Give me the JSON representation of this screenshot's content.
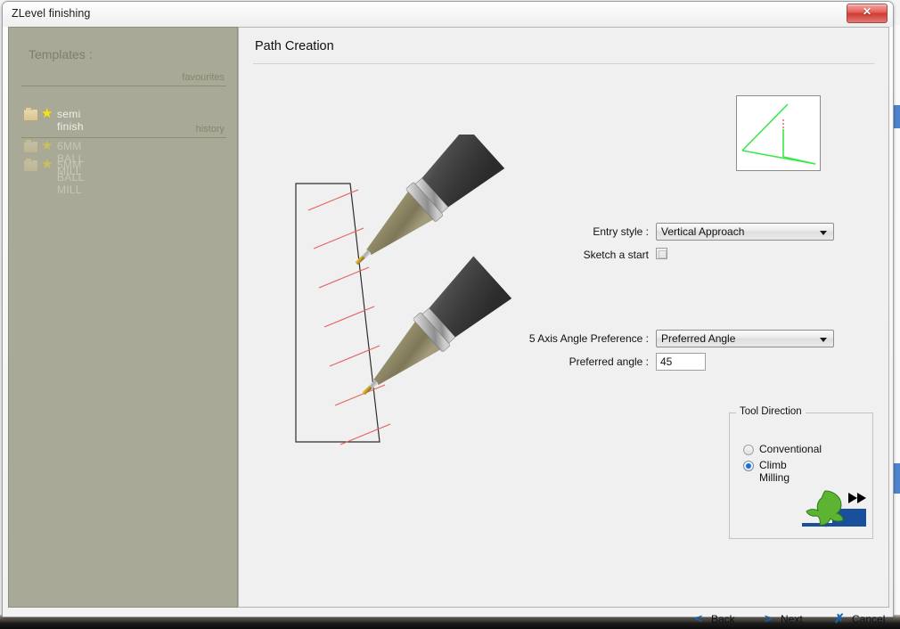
{
  "window": {
    "title": "ZLevel finishing",
    "close_label": "✕",
    "close_icon": "close-icon"
  },
  "sidebar": {
    "heading": "Templates :",
    "sections": [
      {
        "label": "favourites"
      },
      {
        "label": "history"
      }
    ],
    "favourites": [
      {
        "name": "semi finish",
        "icon": "folder-icon",
        "star": "★",
        "active": true
      }
    ],
    "history": [
      {
        "name": "6MM BALL MILL",
        "icon": "folder-icon",
        "star": "★",
        "active": false
      },
      {
        "name": "5MM BALL MILL",
        "icon": "folder-icon",
        "star": "★",
        "active": false
      }
    ]
  },
  "main": {
    "panel_title": "Path Creation",
    "preview": {
      "name": "toolpath-preview"
    },
    "fields": {
      "entry_style_label": "Entry style :",
      "entry_style_value": "Vertical Approach",
      "entry_style_options": [
        "Vertical Approach"
      ],
      "sketch_start_label": "Sketch a start",
      "sketch_start_checked": false,
      "axis_pref_label": "5 Axis Angle Preference :",
      "axis_pref_value": "Preferred Angle",
      "axis_pref_options": [
        "Preferred Angle"
      ],
      "preferred_angle_label": "Preferred angle :",
      "preferred_angle_value": "45"
    },
    "tool_direction": {
      "caption": "Tool Direction",
      "options": [
        {
          "label": "Conventional",
          "selected": false
        },
        {
          "label": "Climb Milling",
          "selected": true
        }
      ],
      "graphic_colors": {
        "cutter": "#5cb432",
        "stock": "#1a4f9c",
        "arrow": "#000000"
      }
    },
    "footer": {
      "back_label": "Back",
      "back_icon": "<",
      "next_label": "Next",
      "next_icon": ">",
      "cancel_label": "Cancel",
      "cancel_icon": "✗"
    }
  },
  "colors": {
    "sidebar_bg": "#a9a997",
    "panel_bg": "#f0f0f0",
    "accent_blue": "#1464b4",
    "toolpath_green": "#3de64b",
    "toolpath_red": "#e05050"
  }
}
